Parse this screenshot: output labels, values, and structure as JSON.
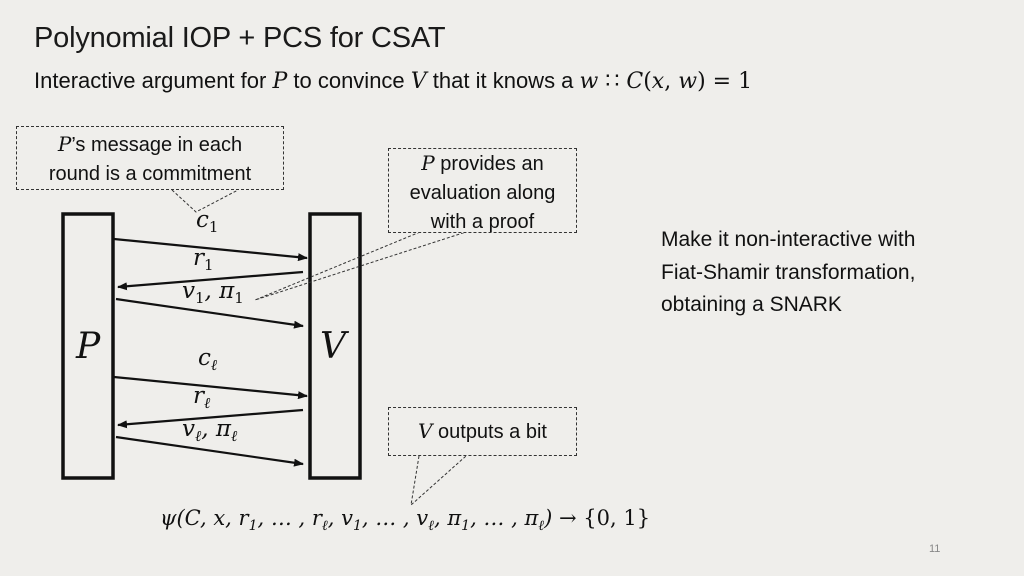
{
  "slide": {
    "title": "Polynomial IOP + PCS for CSAT",
    "subtitle": {
      "t1": "Interactive argument for ",
      "P": "P",
      "t2": " to convince ",
      "V": "V",
      "t3": " that it knows a ",
      "w": "w",
      "sep": " ∷ ",
      "C": "C",
      "open": "(",
      "x": "x",
      "comma": ", ",
      "w2": "w",
      "close": ")",
      "eq": " = 1"
    },
    "page_number": "11"
  },
  "diagram": {
    "prover_label": "P",
    "verifier_label": "V",
    "messages": [
      {
        "name": "c",
        "sub": "1",
        "direction": "P→V"
      },
      {
        "name": "r",
        "sub": "1",
        "direction": "V→P"
      },
      {
        "name": "v",
        "sub": "1",
        "extra": "π",
        "extra_sub": "1",
        "direction": "P→V"
      },
      {
        "name": "c",
        "sub": "ℓ",
        "direction": "P→V"
      },
      {
        "name": "r",
        "sub": "ℓ",
        "direction": "V→P"
      },
      {
        "name": "v",
        "sub": "ℓ",
        "extra": "π",
        "extra_sub": "ℓ",
        "direction": "P→V"
      }
    ],
    "callouts": {
      "commitment": {
        "math": "P",
        "line1": "’s message in each",
        "line2": "round is a commitment"
      },
      "evaluation": {
        "math": "P",
        "line1": " provides an",
        "line2": "evaluation along",
        "line3": "with a proof"
      },
      "output": {
        "math": "V",
        "text": " outputs a bit"
      }
    },
    "formula": {
      "psi": "ψ",
      "args": "(C, x, r",
      "s1": "1",
      "a2": ", … , r",
      "s2": "ℓ",
      "a3": ", v",
      "s3": "1",
      "a4": ", … , v",
      "s4": "ℓ",
      "a5": ", π",
      "s5": "1",
      "a6": ", … , π",
      "s6": "ℓ",
      "a7": ")",
      "arrow": " → {0, 1}"
    }
  },
  "side_note": {
    "line1": "Make it non-interactive with",
    "line2": "Fiat-Shamir transformation,",
    "line3": "obtaining a SNARK"
  },
  "colors": {
    "background": "#efeeeb",
    "ink": "#111111",
    "page_number": "#888888"
  }
}
